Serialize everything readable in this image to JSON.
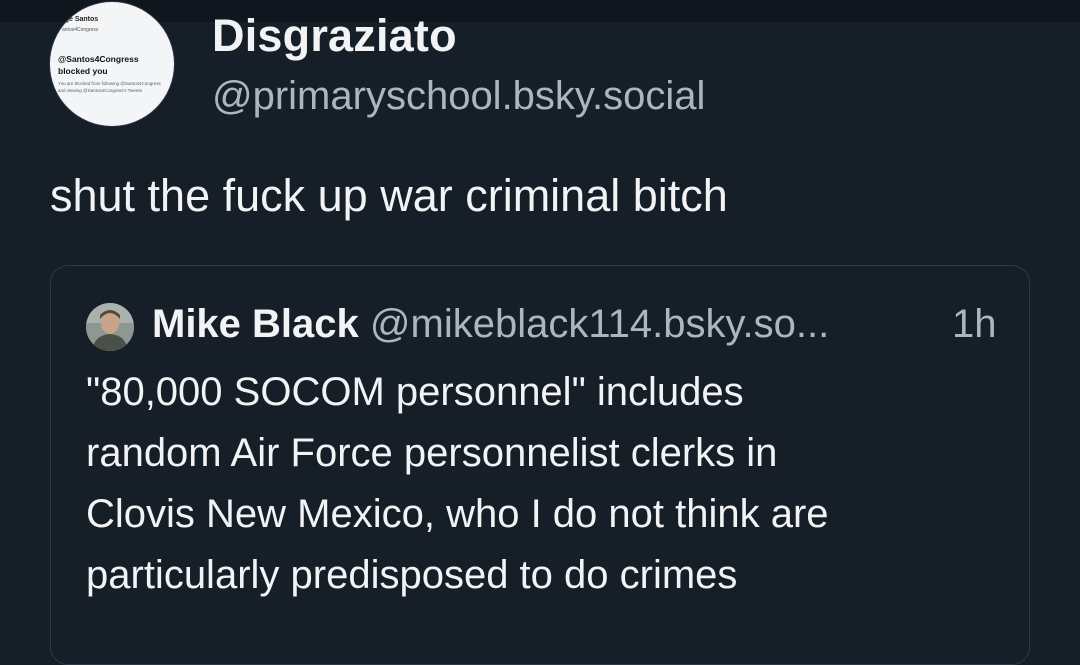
{
  "author": {
    "display_name": "Disgraziato",
    "handle": "@primaryschool.bsky.social",
    "avatar_image": {
      "name": "rge Santos",
      "sub": "antos4Congress",
      "line1": "@Santos4Congress",
      "line2": "blocked you",
      "line3": "You are blocked from following @Santos4Congress",
      "line4": "and viewing @Santos4Congress's Tweets"
    }
  },
  "post": {
    "text": "shut the fuck up war criminal bitch"
  },
  "quote": {
    "display_name": "Mike Black",
    "handle": "@mikeblack114.bsky.so...",
    "time": "1h",
    "lines": [
      "\"80,000 SOCOM personnel\" includes",
      "random Air Force personnelist clerks in",
      "Clovis New Mexico, who I do not think are",
      "particularly predisposed to do crimes"
    ]
  },
  "colors": {
    "background": "#161e27",
    "text_primary": "#f1f3f5",
    "text_secondary": "#aab6c2",
    "quote_border": "#2e3946"
  }
}
